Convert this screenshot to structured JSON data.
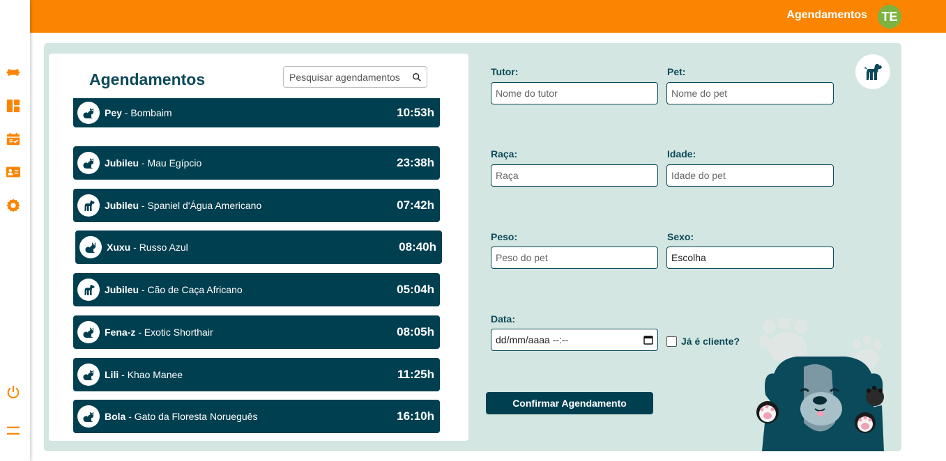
{
  "header": {
    "title": "Agendamentos",
    "avatar_initials": "TE"
  },
  "sidebar": {
    "items": [
      {
        "name": "bone-icon"
      },
      {
        "name": "dashboard-icon"
      },
      {
        "name": "calendar-check-icon"
      },
      {
        "name": "contact-card-icon"
      },
      {
        "name": "gear-icon"
      },
      {
        "name": "power-icon"
      },
      {
        "name": "menu-icon"
      }
    ],
    "accent": "#fb8500"
  },
  "list": {
    "title": "Agendamentos",
    "search_placeholder": "Pesquisar agendamentos",
    "items": [
      {
        "pet": "Pey",
        "breed": "Bombaim",
        "time": "10:53h",
        "kind": "cat-icon"
      },
      {
        "pet": "Jubileu",
        "breed": "Mau Egípcio",
        "time": "23:38h",
        "kind": "cat-icon"
      },
      {
        "pet": "Jubileu",
        "breed": "Spaniel d'Água Americano",
        "time": "07:42h",
        "kind": "dog-icon"
      },
      {
        "pet": "Xuxu",
        "breed": "Russo Azul",
        "time": "08:40h",
        "kind": "cat-icon"
      },
      {
        "pet": "Jubileu",
        "breed": "Cão de Caça Africano",
        "time": "05:04h",
        "kind": "dog-icon"
      },
      {
        "pet": "Fena-z",
        "breed": "Exotic Shorthair",
        "time": "08:05h",
        "kind": "cat-icon"
      },
      {
        "pet": "Lili",
        "breed": "Khao Manee",
        "time": "11:25h",
        "kind": "cat-icon"
      },
      {
        "pet": "Bola",
        "breed": "Gato da Floresta Norueguês",
        "time": "16:10h",
        "kind": "cat-icon"
      }
    ]
  },
  "form": {
    "tutor_label": "Tutor:",
    "tutor_placeholder": "Nome do tutor",
    "pet_label": "Pet:",
    "pet_placeholder": "Nome do pet",
    "raca_label": "Raça:",
    "raca_placeholder": "Raça",
    "idade_label": "Idade:",
    "idade_placeholder": "Idade do pet",
    "peso_label": "Peso:",
    "peso_placeholder": "Peso do pet",
    "sexo_label": "Sexo:",
    "sexo_value": "Escolha",
    "data_label": "Data:",
    "data_placeholder": "dd/mm/aaaa --:--",
    "cliente_label": "Já é cliente?",
    "confirm_label": "Confirmar Agendamento"
  },
  "colors": {
    "primary": "#003f50",
    "accent": "#fb8500",
    "panel": "#d3e6e1"
  }
}
